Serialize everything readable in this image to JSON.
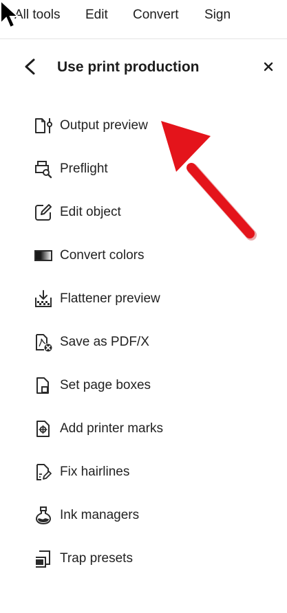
{
  "topnav": {
    "items": [
      {
        "label": "All tools"
      },
      {
        "label": "Edit"
      },
      {
        "label": "Convert"
      },
      {
        "label": "Sign"
      }
    ]
  },
  "panel": {
    "title": "Use print production"
  },
  "tools": [
    {
      "label": "Output preview",
      "icon": "output-preview-icon"
    },
    {
      "label": "Preflight",
      "icon": "preflight-icon"
    },
    {
      "label": "Edit object",
      "icon": "edit-object-icon"
    },
    {
      "label": "Convert colors",
      "icon": "convert-colors-icon"
    },
    {
      "label": "Flattener preview",
      "icon": "flattener-preview-icon"
    },
    {
      "label": "Save as PDF/X",
      "icon": "save-pdfx-icon"
    },
    {
      "label": "Set page boxes",
      "icon": "page-boxes-icon"
    },
    {
      "label": "Add printer marks",
      "icon": "printer-marks-icon"
    },
    {
      "label": "Fix hairlines",
      "icon": "fix-hairlines-icon"
    },
    {
      "label": "Ink managers",
      "icon": "ink-manager-icon"
    },
    {
      "label": "Trap presets",
      "icon": "trap-presets-icon"
    }
  ],
  "colors": {
    "annotation_arrow": "#e4141b",
    "icon_stroke": "#2a2a2a"
  }
}
